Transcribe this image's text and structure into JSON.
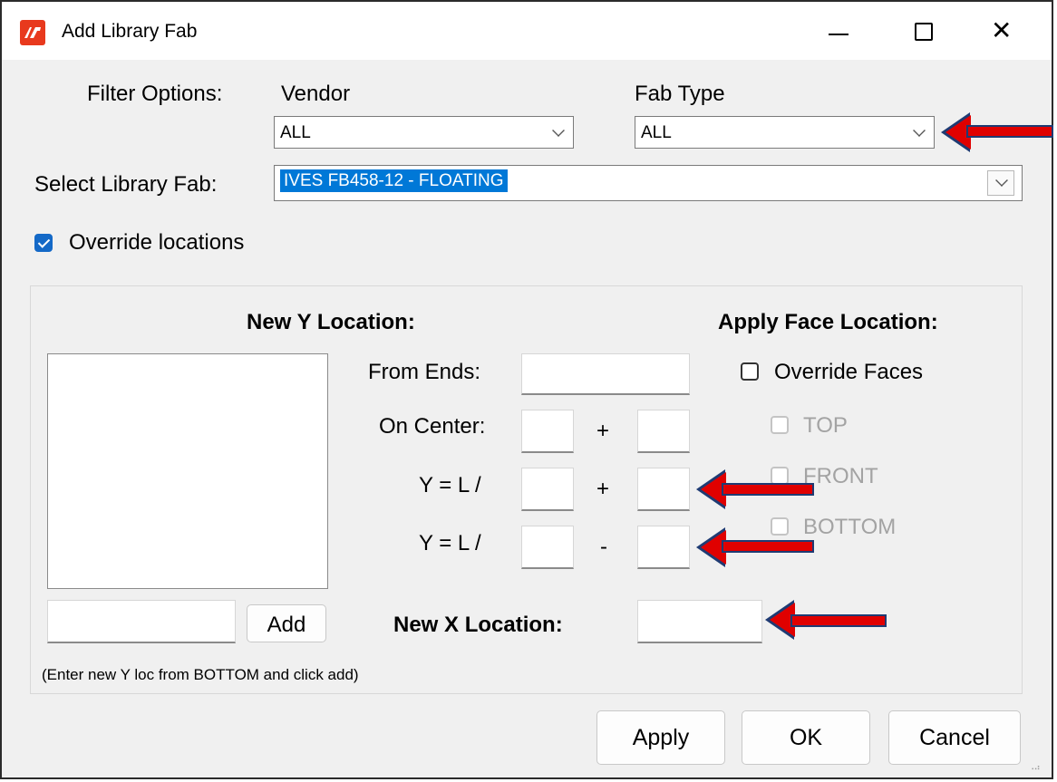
{
  "window": {
    "title": "Add Library Fab",
    "minimize_icon": "minimize-icon",
    "maximize_icon": "maximize-icon",
    "close_icon": "close-icon",
    "close_glyph": "✕"
  },
  "filter": {
    "label": "Filter Options:",
    "vendor_label": "Vendor",
    "vendor_value": "ALL",
    "fabtype_label": "Fab Type",
    "fabtype_value": "ALL"
  },
  "select_fab": {
    "label": "Select Library Fab:",
    "value": "IVES FB458-12 - FLOATING"
  },
  "override_locations": {
    "label": "Override locations",
    "checked": true
  },
  "y_location": {
    "heading": "New Y Location:",
    "from_ends_label": "From Ends:",
    "on_center_label": "On Center:",
    "plus1": "+",
    "yl1_label": "Y = L /",
    "plus2": "+",
    "yl2_label": "Y = L /",
    "minus": "-",
    "add_button": "Add",
    "hint": "(Enter new Y loc from BOTTOM and click add)"
  },
  "x_location": {
    "label": "New X Location:"
  },
  "face": {
    "heading": "Apply Face Location:",
    "override_faces": "Override Faces",
    "top": "TOP",
    "front": "FRONT",
    "bottom": "BOTTOM"
  },
  "buttons": {
    "apply": "Apply",
    "ok": "OK",
    "cancel": "Cancel"
  },
  "colors": {
    "accent": "#0078d7",
    "arrow": "#e00000",
    "arrow_outline": "#1f3b73",
    "app_icon": "#e8391d"
  }
}
